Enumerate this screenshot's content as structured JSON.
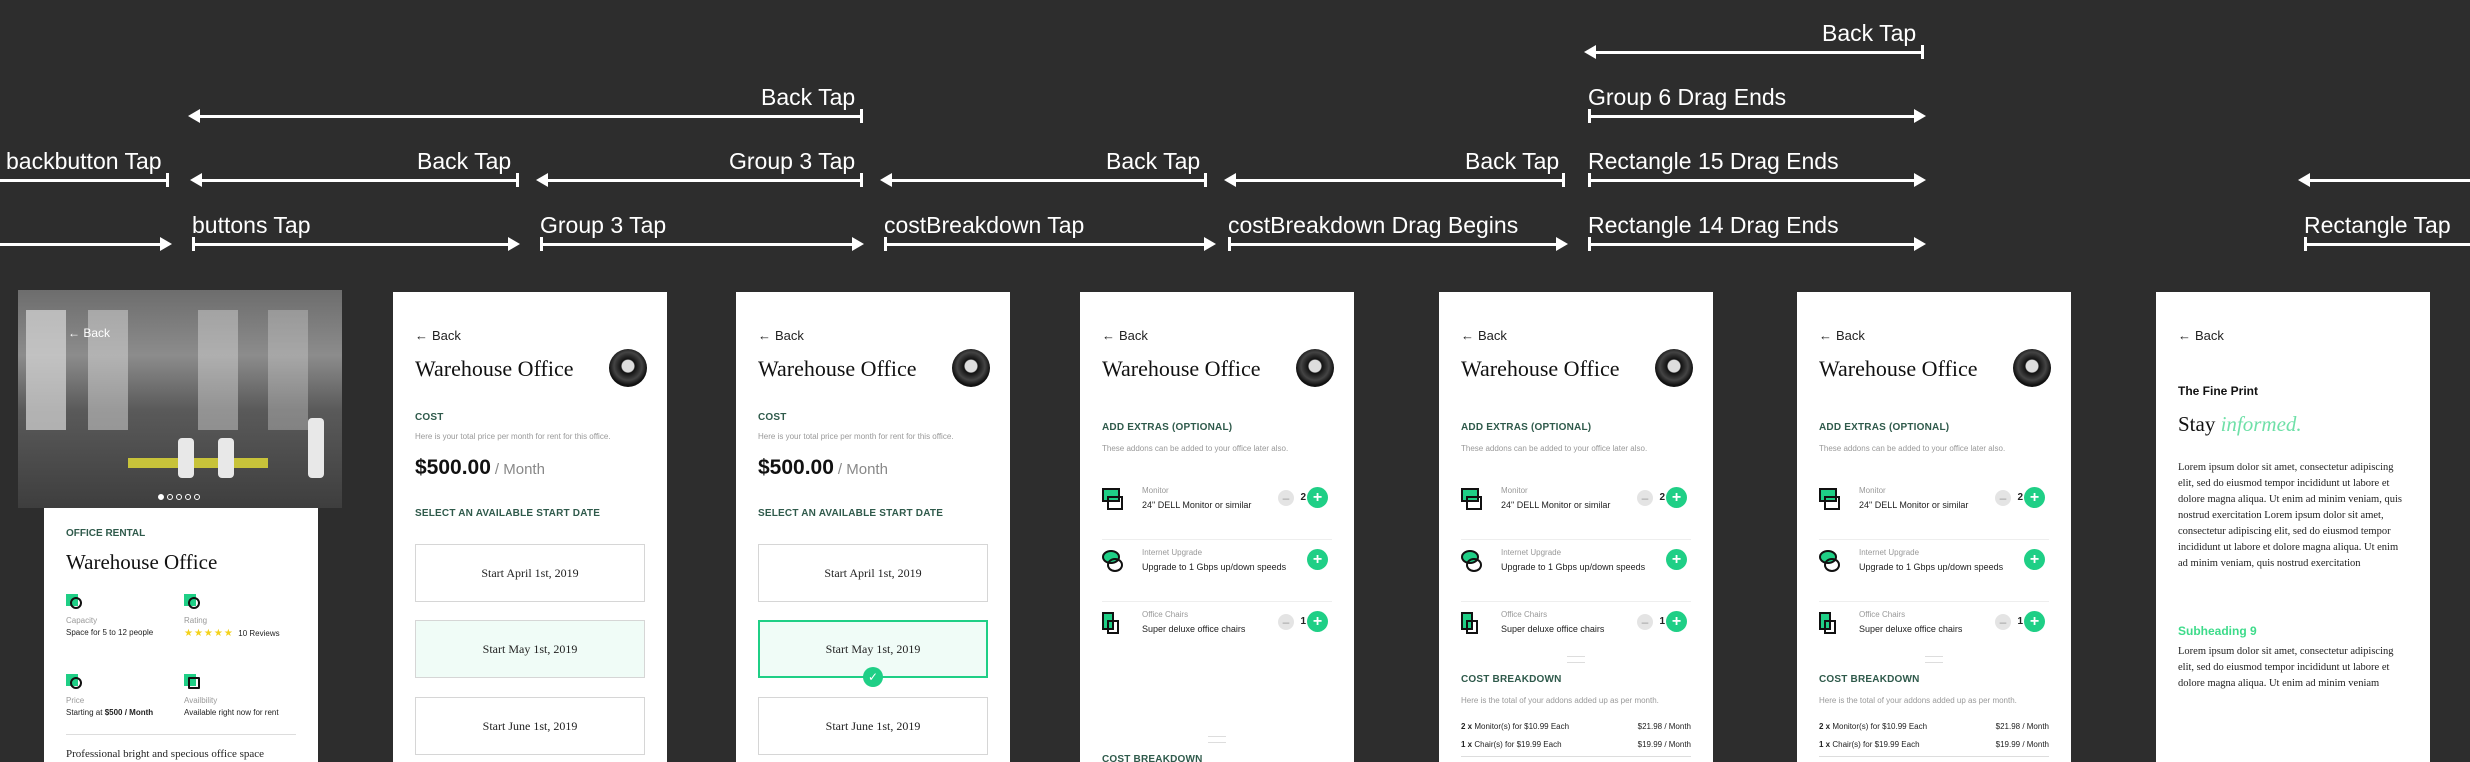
{
  "flow_labels": {
    "f1": "backbutton Tap",
    "f2": "buttons Tap",
    "f3": "Back Tap",
    "f4": "Back Tap",
    "f5": "Group 3 Tap",
    "f6": "Group 3 Tap",
    "f7": "Back Tap",
    "f8": "costBreakdown Tap",
    "f9": "Back Tap",
    "f10": "costBreakdown Drag Begins",
    "f11": "Back Tap",
    "f12": "Group 6 Drag Ends",
    "f13": "Rectangle 15 Drag Ends",
    "f14": "Rectangle 14 Drag Ends",
    "f15": "Rectangle Tap"
  },
  "common": {
    "back": "Back",
    "title": "Warehouse Office",
    "cost_heading": "COST",
    "cost_sub": "Here is your total price per month for rent for this office.",
    "price": "$500.00",
    "per_month": "/ Month",
    "start_heading": "SELECT AN AVAILABLE START DATE",
    "dates": [
      "Start April 1st, 2019",
      "Start May 1st, 2019",
      "Start June 1st, 2019"
    ],
    "extras_heading": "ADD EXTRAS (OPTIONAL)",
    "extras_sub": "These addons can be added to your office later also.",
    "addons": [
      {
        "name": "Monitor",
        "desc": "24\" DELL Monitor or similar",
        "qty": "2"
      },
      {
        "name": "Internet Upgrade",
        "desc": "Upgrade to 1 Gbps up/down speeds",
        "qty": ""
      },
      {
        "name": "Office Chairs",
        "desc": "Super deluxe office chairs",
        "qty": "1"
      }
    ],
    "breakdown_heading": "COST BREAKDOWN",
    "breakdown_heading_partial": "COST BREAKDOWN",
    "breakdown_sub": "Here is the total of your addons added up as per month.",
    "breakdown": [
      {
        "qty": "2 x",
        "label": "Monitor(s) for $10.99 Each",
        "value": "$21.98 / Month"
      },
      {
        "qty": "1 x",
        "label": "Chair(s) for $19.99 Each",
        "value": "$19.99 / Month"
      }
    ],
    "minus": "–",
    "plus": "+"
  },
  "screen1": {
    "kicker": "OFFICE RENTAL",
    "title": "Warehouse Office",
    "back": "Back",
    "capacity_label": "Capacity",
    "capacity_value": "Space for 5 to 12 people",
    "rating_label": "Rating",
    "rating_stars": "★★★★★",
    "rating_reviews": "10 Reviews",
    "price_label": "Price",
    "price_value_prefix": "Starting at ",
    "price_value_bold": "$500 / Month",
    "availability_label": "Availbility",
    "availability_value": "Available right now for rent",
    "description": "Professional bright and specious office space"
  },
  "screen7": {
    "back": "Back",
    "fine_print": "The Fine Print",
    "stay": "Stay",
    "informed": "informed.",
    "para1": "Lorem ipsum dolor sit amet, consectetur adipiscing elit, sed do eiusmod tempor incididunt ut labore et dolore magna aliqua. Ut enim ad minim veniam, quis nostrud exercitation Lorem ipsum dolor sit amet, consectetur adipiscing elit, sed do eiusmod tempor incididunt ut labore et dolore magna aliqua. Ut enim ad minim veniam, quis nostrud exercitation",
    "subheading": "Subheading 9",
    "para2": "Lorem ipsum dolor sit amet, consectetur adipiscing elit, sed do eiusmod tempor incididunt ut labore et dolore magna aliqua. Ut enim ad minim veniam"
  },
  "colors": {
    "background": "#2d2d2d",
    "accent": "#1fcf86",
    "heading_green": "#2f5a4b",
    "star": "#f4d21c"
  }
}
